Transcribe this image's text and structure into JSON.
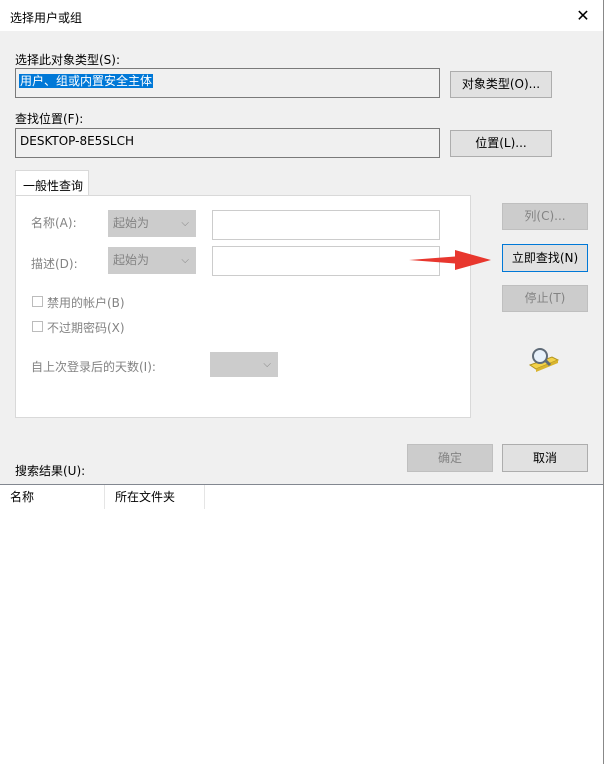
{
  "window": {
    "title": "选择用户或组",
    "close_glyph": "✕"
  },
  "object_type": {
    "label": "选择此对象类型(S):",
    "value": "用户、组或内置安全主体",
    "button": "对象类型(O)..."
  },
  "location": {
    "label": "查找位置(F):",
    "value": "DESKTOP-8E5SLCH",
    "button": "位置(L)..."
  },
  "tab": {
    "label": "一般性查询"
  },
  "query": {
    "name_label": "名称(A):",
    "name_mode": "起始为",
    "desc_label": "描述(D):",
    "desc_mode": "起始为",
    "disabled_accounts": "禁用的帐户(B)",
    "non_expiring_pw": "不过期密码(X)",
    "days_label": "自上次登录后的天数(I):",
    "combo_arrow": "⌵"
  },
  "side_buttons": {
    "columns": "列(C)...",
    "find_now": "立即查找(N)",
    "stop": "停止(T)"
  },
  "footer": {
    "ok": "确定",
    "cancel": "取消"
  },
  "results": {
    "label": "搜索结果(U):",
    "columns": [
      "名称",
      "所在文件夹"
    ]
  },
  "colors": {
    "accent": "#0078d7",
    "arrow": "#e8372e"
  }
}
